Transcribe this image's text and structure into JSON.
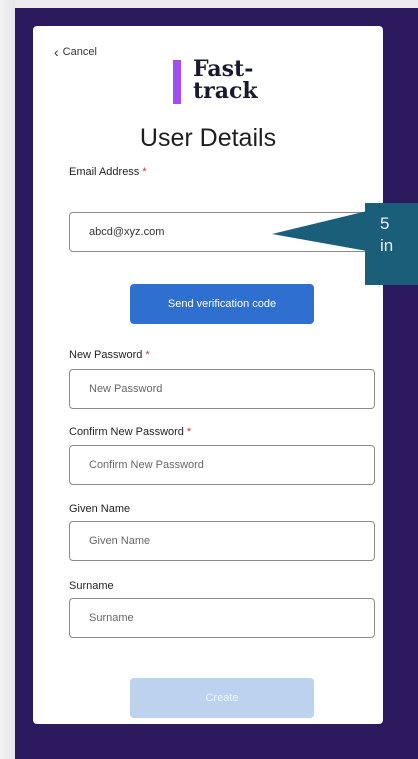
{
  "cancel_label": "Cancel",
  "logo": {
    "line1": "Fast-",
    "line2": "track"
  },
  "title": "User Details",
  "email": {
    "label": "Email Address",
    "required_mark": "*",
    "value": "abcd@xyz.com"
  },
  "verify_button": "Send verification code",
  "new_password": {
    "label": "New Password",
    "required_mark": "*",
    "placeholder": "New Password"
  },
  "confirm_password": {
    "label": "Confirm New Password",
    "required_mark": "*",
    "placeholder": "Confirm New Password"
  },
  "given_name": {
    "label": "Given Name",
    "placeholder": "Given Name"
  },
  "surname": {
    "label": "Surname",
    "placeholder": "Surname"
  },
  "create_button": "Create",
  "callout": {
    "line1": "5",
    "line2": "in"
  },
  "colors": {
    "frame": "#2d1a5e",
    "primary_button": "#2f6fd0",
    "disabled_button": "#bcd2ee",
    "logo_bar": "#a34ff0",
    "callout": "#1a5e7a",
    "required": "#c0392b"
  }
}
